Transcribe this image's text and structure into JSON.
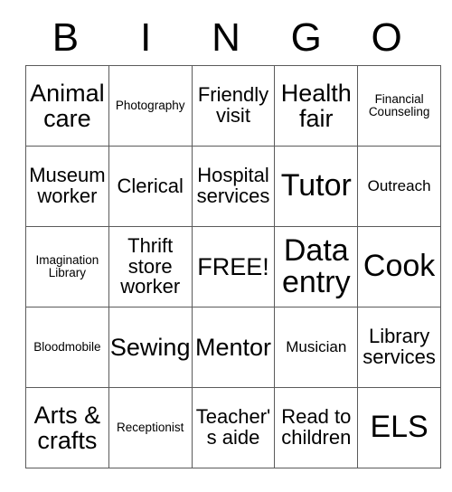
{
  "card": {
    "header": {
      "letters": [
        "B",
        "I",
        "N",
        "G",
        "O"
      ]
    },
    "rows": [
      [
        {
          "label": "Animal care",
          "size": "lg"
        },
        {
          "label": "Photography",
          "size": "xs"
        },
        {
          "label": "Friendly visit",
          "size": "md"
        },
        {
          "label": "Health fair",
          "size": "lg"
        },
        {
          "label": "Financial Counseling",
          "size": "xs"
        }
      ],
      [
        {
          "label": "Museum worker",
          "size": "md"
        },
        {
          "label": "Clerical",
          "size": "md"
        },
        {
          "label": "Hospital services",
          "size": "md"
        },
        {
          "label": "Tutor",
          "size": "xl"
        },
        {
          "label": "Outreach",
          "size": "sm"
        }
      ],
      [
        {
          "label": "Imagination Library",
          "size": "xs"
        },
        {
          "label": "Thrift store worker",
          "size": "md"
        },
        {
          "label": "FREE!",
          "size": "lg"
        },
        {
          "label": "Data entry",
          "size": "xl"
        },
        {
          "label": "Cook",
          "size": "xl"
        }
      ],
      [
        {
          "label": "Bloodmobile",
          "size": "xs"
        },
        {
          "label": "Sewing",
          "size": "lg"
        },
        {
          "label": "Mentor",
          "size": "lg"
        },
        {
          "label": "Musician",
          "size": "sm"
        },
        {
          "label": "Library services",
          "size": "md"
        }
      ],
      [
        {
          "label": "Arts & crafts",
          "size": "lg"
        },
        {
          "label": "Receptionist",
          "size": "xs"
        },
        {
          "label": "Teacher's aide",
          "size": "md"
        },
        {
          "label": "Read to children",
          "size": "md"
        },
        {
          "label": "ELS",
          "size": "xl"
        }
      ]
    ],
    "colors": {
      "grid_line": "#5b5b5b",
      "text": "#000000",
      "background": "#ffffff"
    }
  }
}
